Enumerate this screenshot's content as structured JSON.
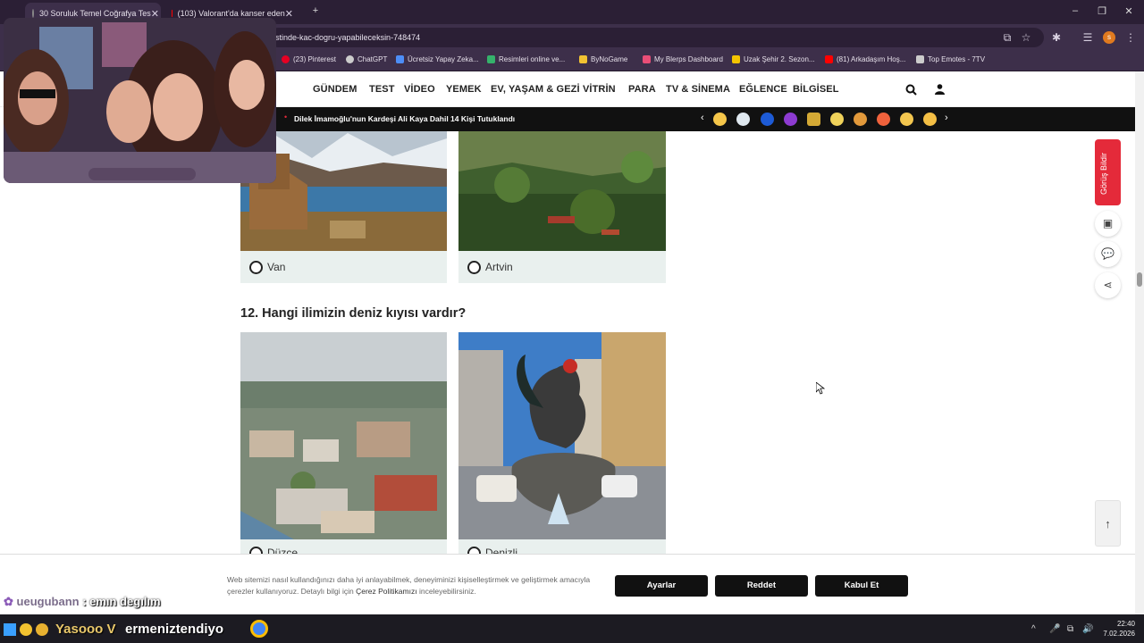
{
  "browser": {
    "tabs": [
      {
        "title": "30 Soruluk Temel Coğrafya Tes"
      },
      {
        "title": "(103) Valorant'da kanser eden"
      }
    ],
    "url": "stinde-kac-dogru-yapabileceksin-748474",
    "bookmarks": [
      {
        "label": "(23) Pinterest",
        "color": "#e60023"
      },
      {
        "label": "ChatGPT",
        "color": "#cccccc"
      },
      {
        "label": "Ücretsiz Yapay Zeka...",
        "color": "#4d8ef7"
      },
      {
        "label": "Resimleri online ve...",
        "color": "#35b26b"
      },
      {
        "label": "ByNoGame",
        "color": "#f1c232"
      },
      {
        "label": "My Blerps Dashboard",
        "color": "#e94e77"
      },
      {
        "label": "Uzak Şehir 2. Sezon...",
        "color": "#f4c400"
      },
      {
        "label": "(81) Arkadaşım Hoş...",
        "color": "#ff0000"
      },
      {
        "label": "Top Emotes - 7TV",
        "color": "#cccccc"
      }
    ]
  },
  "site": {
    "nav": [
      "GÜNDEM",
      "TEST",
      "VİDEO",
      "YEMEK",
      "EV, YAŞAM & GEZİ",
      "VİTRİN",
      "PARA",
      "TV & SİNEMA",
      "EĞLENCE",
      "BİLGİSEL"
    ],
    "ticker_news": "Dilek İmamoğlu'nun Kardeşi Ali Kaya Dahil 14 Kişi Tutuklandı",
    "feedback_label": "Görüş Bildir"
  },
  "quiz": {
    "prev_options": [
      {
        "label": "Van"
      },
      {
        "label": "Artvin"
      }
    ],
    "question": "12. Hangi ilimizin deniz kıyısı vardır?",
    "options": [
      {
        "label": "Düzce"
      },
      {
        "label": "Denizli"
      }
    ]
  },
  "cookie": {
    "text_before": "Web sitemizi nasıl kullandığınızı daha iyi anlayabilmek, deneyiminizi kişiselleştirmek ve geliştirmek amacıyla çerezler kullanıyoruz. Detaylı bilgi için ",
    "link": "Çerez Politikamızı",
    "text_after": " inceleyebilirsiniz.",
    "buttons": {
      "settings": "Ayarlar",
      "reject": "Reddet",
      "accept": "Kabul Et"
    }
  },
  "overlay": {
    "chat_user": "ueugubann",
    "chat_message": ": emın degılım",
    "banner_left": "Yasooo V",
    "banner_right": "ermeniztendiyo"
  },
  "taskbar": {
    "time": "22:40",
    "date": "7.02.2026"
  }
}
